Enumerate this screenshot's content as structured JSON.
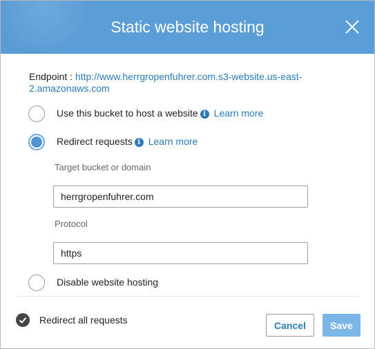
{
  "dialog": {
    "title": "Static website hosting",
    "close_icon": "close-icon"
  },
  "endpoint": {
    "label": "Endpoint :",
    "url": "http://www.herrgropenfuhrer.com.s3-website.us-east-2.amazonaws.com"
  },
  "options": {
    "host": {
      "label": "Use this bucket to host a website",
      "learn_more": "Learn more",
      "selected": false
    },
    "redirect": {
      "label": "Redirect requests",
      "learn_more": "Learn more",
      "selected": true
    },
    "disable": {
      "label": "Disable website hosting",
      "selected": false
    }
  },
  "redirect_form": {
    "target_label": "Target bucket or domain",
    "target_value": "herrgropenfuhrer.com",
    "protocol_label": "Protocol",
    "protocol_value": "https"
  },
  "footer": {
    "status_text": "Redirect all requests",
    "cancel_label": "Cancel",
    "save_label": "Save"
  },
  "colors": {
    "header": "#5b9dd6",
    "link": "#2a7ab8",
    "save_button": "#7bb6e6"
  }
}
